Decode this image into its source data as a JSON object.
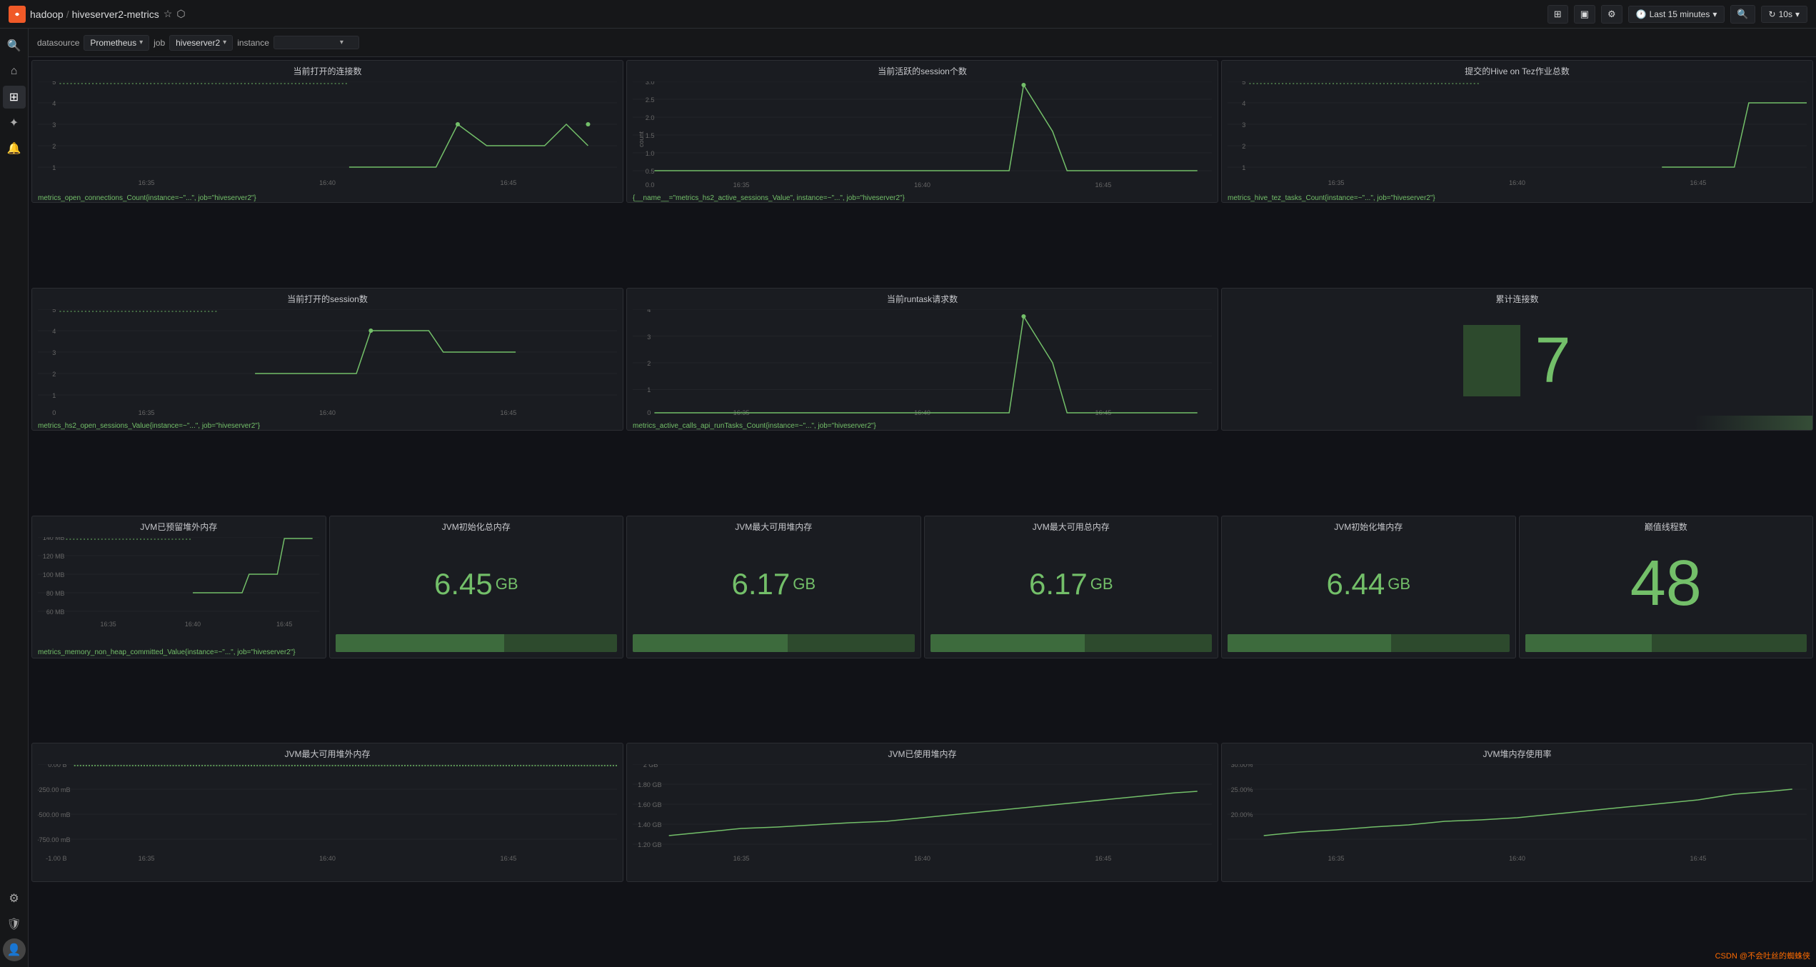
{
  "topbar": {
    "logo": "G",
    "breadcrumb": {
      "part1": "hadoop",
      "sep1": "/",
      "part2": "hiveserver2-metrics"
    },
    "time_range": "Last 15 minutes",
    "refresh": "10s"
  },
  "filterbar": {
    "datasource_label": "datasource",
    "datasource_value": "Prometheus",
    "job_label": "job",
    "job_value": "hiveserver2",
    "instance_label": "instance",
    "instance_value": ""
  },
  "panels": {
    "row1": [
      {
        "title": "当前打开的连接数",
        "legend": "metrics_open_connections_Count{instance=~\"...\", job=\"hiveserver2\"}"
      },
      {
        "title": "当前活跃的session个数",
        "legend": "{__name__=\"metrics_hs2_active_sessions_Value\", instance=~\"...\", job=\"hiveserver2\"}"
      },
      {
        "title": "提交的Hive on Tez作业总数",
        "legend": "metrics_hive_tez_tasks_Count{instance=~\"...\", job=\"hiveserver2\"}"
      }
    ],
    "row2": [
      {
        "title": "当前打开的session数",
        "legend": "metrics_hs2_open_sessions_Value{instance=~\"...\", job=\"hiveserver2\"}"
      },
      {
        "title": "当前runtask请求数",
        "legend": "metrics_active_calls_api_runTasks_Count{instance=~\"...\", job=\"hiveserver2\"}"
      },
      {
        "title": "累计连接数",
        "value": "7",
        "type": "stat"
      }
    ],
    "row3": [
      {
        "title": "JVM已预留堆外内存",
        "legend": "metrics_memory_non_heap_committed_Value{instance=~\"...\", job=\"hiveserver2\"}"
      },
      {
        "title": "JVM初始化总内存",
        "value": "6.45",
        "unit": "GB"
      },
      {
        "title": "JVM最大可用堆内存",
        "value": "6.17",
        "unit": "GB"
      },
      {
        "title": "JVM最大可用总内存",
        "value": "6.17",
        "unit": "GB"
      },
      {
        "title": "JVM初始化堆内存",
        "value": "6.44",
        "unit": "GB"
      },
      {
        "title": "巅值线程数",
        "value": "48"
      }
    ],
    "row4": [
      {
        "title": "JVM最大可用堆外内存",
        "legend": ""
      },
      {
        "title": "JVM已使用堆内存",
        "legend": ""
      },
      {
        "title": "JVM堆内存使用率",
        "legend": ""
      }
    ]
  },
  "watermark": "CSDN @不会吐丝的蜘蛛侠"
}
